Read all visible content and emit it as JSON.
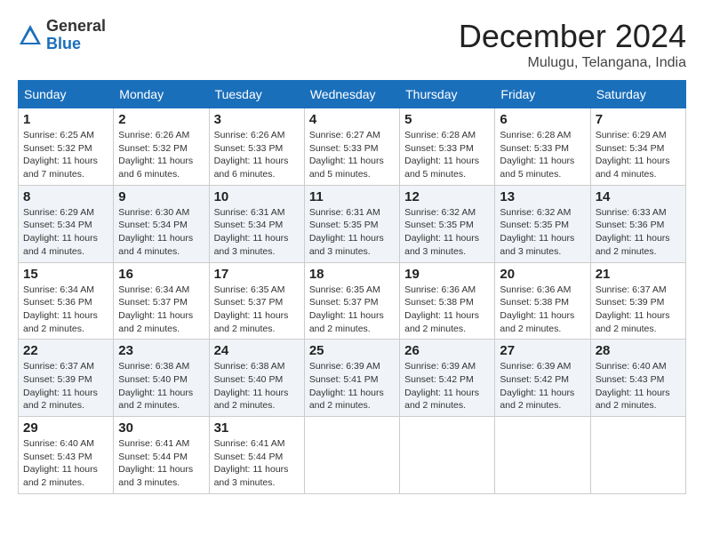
{
  "logo": {
    "general": "General",
    "blue": "Blue"
  },
  "title": "December 2024",
  "subtitle": "Mulugu, Telangana, India",
  "weekdays": [
    "Sunday",
    "Monday",
    "Tuesday",
    "Wednesday",
    "Thursday",
    "Friday",
    "Saturday"
  ],
  "weeks": [
    [
      {
        "day": "1",
        "sunrise": "6:25 AM",
        "sunset": "5:32 PM",
        "daylight": "11 hours and 7 minutes."
      },
      {
        "day": "2",
        "sunrise": "6:26 AM",
        "sunset": "5:32 PM",
        "daylight": "11 hours and 6 minutes."
      },
      {
        "day": "3",
        "sunrise": "6:26 AM",
        "sunset": "5:33 PM",
        "daylight": "11 hours and 6 minutes."
      },
      {
        "day": "4",
        "sunrise": "6:27 AM",
        "sunset": "5:33 PM",
        "daylight": "11 hours and 5 minutes."
      },
      {
        "day": "5",
        "sunrise": "6:28 AM",
        "sunset": "5:33 PM",
        "daylight": "11 hours and 5 minutes."
      },
      {
        "day": "6",
        "sunrise": "6:28 AM",
        "sunset": "5:33 PM",
        "daylight": "11 hours and 5 minutes."
      },
      {
        "day": "7",
        "sunrise": "6:29 AM",
        "sunset": "5:34 PM",
        "daylight": "11 hours and 4 minutes."
      }
    ],
    [
      {
        "day": "8",
        "sunrise": "6:29 AM",
        "sunset": "5:34 PM",
        "daylight": "11 hours and 4 minutes."
      },
      {
        "day": "9",
        "sunrise": "6:30 AM",
        "sunset": "5:34 PM",
        "daylight": "11 hours and 4 minutes."
      },
      {
        "day": "10",
        "sunrise": "6:31 AM",
        "sunset": "5:34 PM",
        "daylight": "11 hours and 3 minutes."
      },
      {
        "day": "11",
        "sunrise": "6:31 AM",
        "sunset": "5:35 PM",
        "daylight": "11 hours and 3 minutes."
      },
      {
        "day": "12",
        "sunrise": "6:32 AM",
        "sunset": "5:35 PM",
        "daylight": "11 hours and 3 minutes."
      },
      {
        "day": "13",
        "sunrise": "6:32 AM",
        "sunset": "5:35 PM",
        "daylight": "11 hours and 3 minutes."
      },
      {
        "day": "14",
        "sunrise": "6:33 AM",
        "sunset": "5:36 PM",
        "daylight": "11 hours and 2 minutes."
      }
    ],
    [
      {
        "day": "15",
        "sunrise": "6:34 AM",
        "sunset": "5:36 PM",
        "daylight": "11 hours and 2 minutes."
      },
      {
        "day": "16",
        "sunrise": "6:34 AM",
        "sunset": "5:37 PM",
        "daylight": "11 hours and 2 minutes."
      },
      {
        "day": "17",
        "sunrise": "6:35 AM",
        "sunset": "5:37 PM",
        "daylight": "11 hours and 2 minutes."
      },
      {
        "day": "18",
        "sunrise": "6:35 AM",
        "sunset": "5:37 PM",
        "daylight": "11 hours and 2 minutes."
      },
      {
        "day": "19",
        "sunrise": "6:36 AM",
        "sunset": "5:38 PM",
        "daylight": "11 hours and 2 minutes."
      },
      {
        "day": "20",
        "sunrise": "6:36 AM",
        "sunset": "5:38 PM",
        "daylight": "11 hours and 2 minutes."
      },
      {
        "day": "21",
        "sunrise": "6:37 AM",
        "sunset": "5:39 PM",
        "daylight": "11 hours and 2 minutes."
      }
    ],
    [
      {
        "day": "22",
        "sunrise": "6:37 AM",
        "sunset": "5:39 PM",
        "daylight": "11 hours and 2 minutes."
      },
      {
        "day": "23",
        "sunrise": "6:38 AM",
        "sunset": "5:40 PM",
        "daylight": "11 hours and 2 minutes."
      },
      {
        "day": "24",
        "sunrise": "6:38 AM",
        "sunset": "5:40 PM",
        "daylight": "11 hours and 2 minutes."
      },
      {
        "day": "25",
        "sunrise": "6:39 AM",
        "sunset": "5:41 PM",
        "daylight": "11 hours and 2 minutes."
      },
      {
        "day": "26",
        "sunrise": "6:39 AM",
        "sunset": "5:42 PM",
        "daylight": "11 hours and 2 minutes."
      },
      {
        "day": "27",
        "sunrise": "6:39 AM",
        "sunset": "5:42 PM",
        "daylight": "11 hours and 2 minutes."
      },
      {
        "day": "28",
        "sunrise": "6:40 AM",
        "sunset": "5:43 PM",
        "daylight": "11 hours and 2 minutes."
      }
    ],
    [
      {
        "day": "29",
        "sunrise": "6:40 AM",
        "sunset": "5:43 PM",
        "daylight": "11 hours and 2 minutes."
      },
      {
        "day": "30",
        "sunrise": "6:41 AM",
        "sunset": "5:44 PM",
        "daylight": "11 hours and 3 minutes."
      },
      {
        "day": "31",
        "sunrise": "6:41 AM",
        "sunset": "5:44 PM",
        "daylight": "11 hours and 3 minutes."
      },
      null,
      null,
      null,
      null
    ]
  ]
}
